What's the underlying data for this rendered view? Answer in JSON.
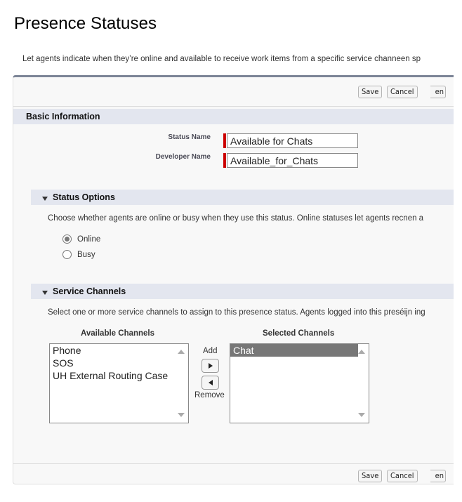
{
  "page": {
    "title": "Presence Statuses",
    "intro": "Let agents indicate when they’re online and available to receive work items from a specific service channe",
    "intro_overflow": "en sp"
  },
  "toolbar": {
    "save_label": "Save",
    "cancel_label": "Cancel",
    "ghost_label": "en"
  },
  "basic_info": {
    "title": "Basic Information",
    "fields": [
      {
        "label": "Status Name",
        "value": "Available for Chats",
        "required": true
      },
      {
        "label": "Developer Name",
        "value": "Available_for_Chats",
        "required": true
      }
    ]
  },
  "status_options": {
    "title": "Status Options",
    "description": "Choose whether agents are online or busy when they use this status. Online statuses let agents rec",
    "description_overflow": "nen a",
    "options": [
      {
        "label": "Online",
        "checked": true
      },
      {
        "label": "Busy",
        "checked": false
      }
    ]
  },
  "service_channels": {
    "title": "Service Channels",
    "description": "Select one or more service channels to assign to this presence status. Agents logged into this presé",
    "description_overflow": "ijn ing",
    "available_label": "Available Channels",
    "selected_label": "Selected Channels",
    "available": [
      "Phone",
      "SOS",
      "UH External Routing Case"
    ],
    "selected": [
      "Chat"
    ],
    "add_label": "Add",
    "remove_label": "Remove"
  },
  "colors": {
    "required_marker": "#cc0000",
    "section_header_bg": "#e3e6ef",
    "panel_top_border": "#7c8597",
    "selected_option_bg": "#777777"
  }
}
